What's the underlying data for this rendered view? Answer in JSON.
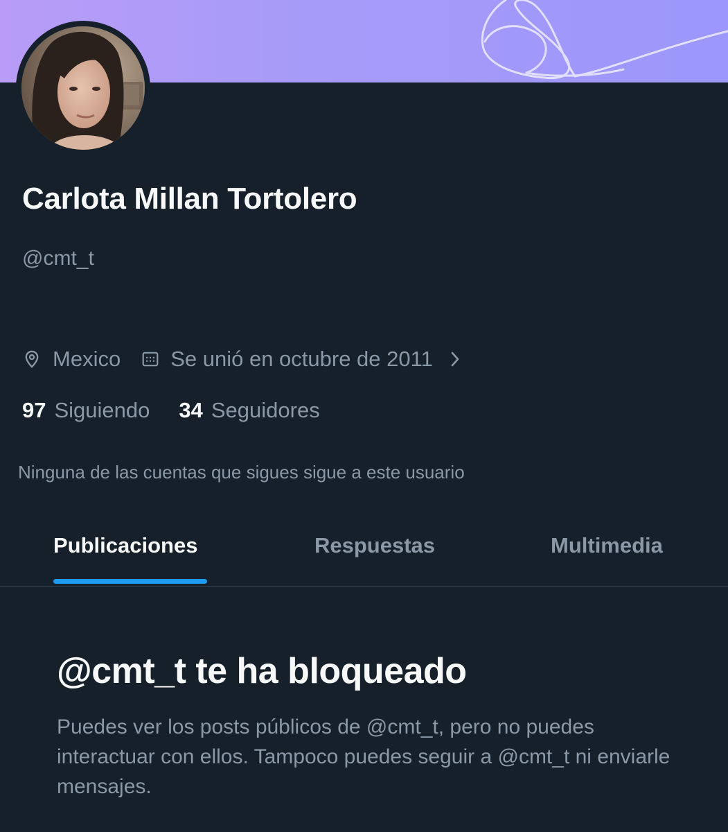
{
  "profile": {
    "display_name": "Carlota Millan Tortolero",
    "handle": "@cmt_t",
    "location": "Mexico",
    "joined": "Se unió en octubre de 2011"
  },
  "stats": {
    "following_count": "97",
    "following_label": "Siguiendo",
    "followers_count": "34",
    "followers_label": "Seguidores"
  },
  "followers_note": "Ninguna de las cuentas que sigues sigue a este usuario",
  "tabs": [
    {
      "label": "Publicaciones",
      "active": true
    },
    {
      "label": "Respuestas",
      "active": false
    },
    {
      "label": "Multimedia",
      "active": false
    }
  ],
  "blocked": {
    "title": "@cmt_t te ha bloqueado",
    "message": "Puedes ver los posts públicos de @cmt_t, pero no puedes interactuar con ellos. Tampoco puedes seguir a @cmt_t ni enviarle mensajes."
  },
  "icons": {
    "location": "location-pin-icon",
    "calendar": "calendar-icon",
    "chevron": "chevron-right-icon"
  },
  "colors": {
    "background": "#15202b",
    "text_primary": "#f7f9f9",
    "text_secondary": "#8b98a5",
    "accent": "#1d9bf0",
    "banner": "#a79bf8"
  }
}
